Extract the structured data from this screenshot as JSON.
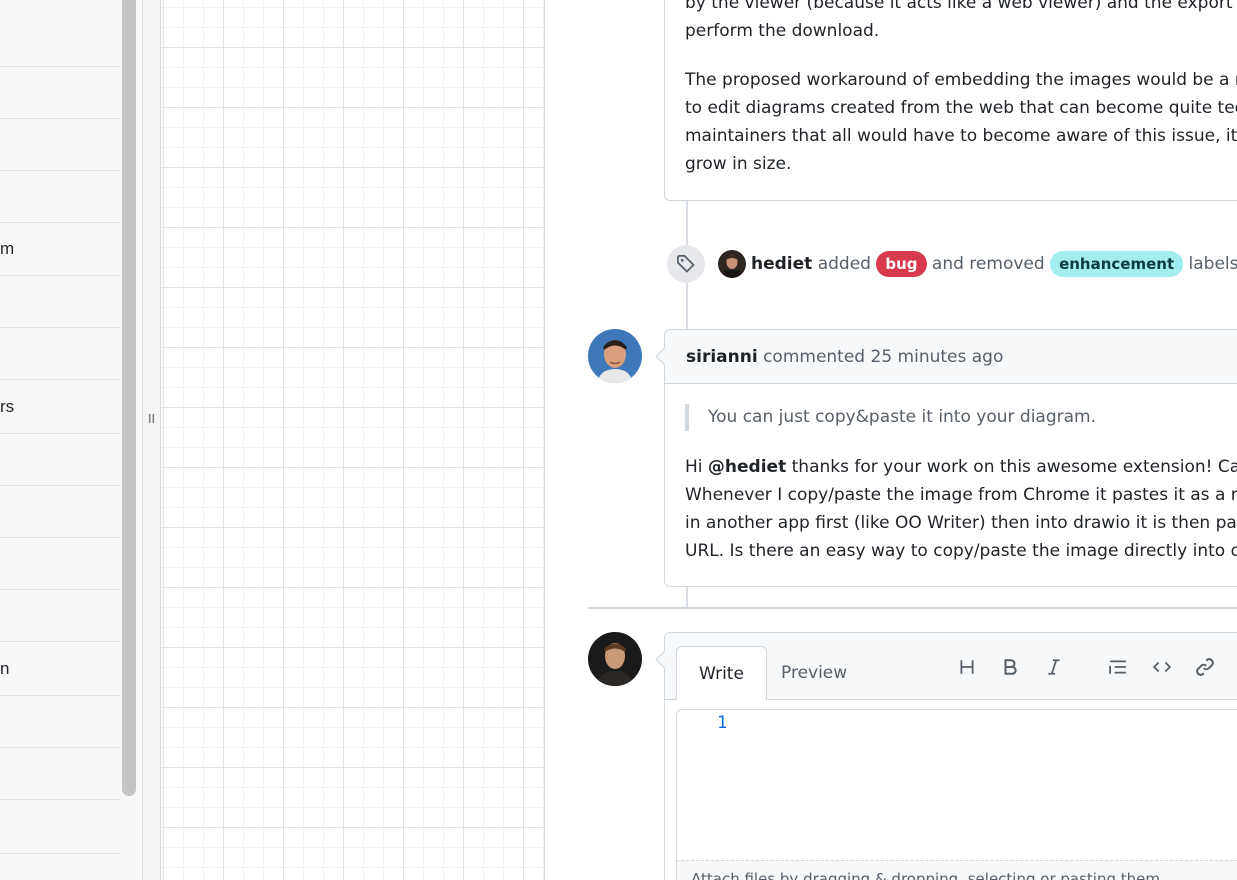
{
  "sidebar": {
    "items": [
      {
        "label": ""
      },
      {
        "label": ""
      },
      {
        "label": ""
      },
      {
        "label": "m"
      },
      {
        "label": ""
      },
      {
        "label": ""
      },
      {
        "label": "rs"
      },
      {
        "label": ""
      },
      {
        "label": ""
      },
      {
        "label": ""
      },
      {
        "label": ""
      },
      {
        "label": ""
      },
      {
        "label": "n"
      },
      {
        "label": ""
      },
      {
        "label": ""
      }
    ],
    "splitter_grip": "II"
  },
  "issue": {
    "previous_comment": {
      "lines": [
        "by the viewer (because it acts like a web viewer) and the export wo",
        "perform the download."
      ],
      "paragraph2": [
        "The proposed workaround of embedding the images would be a m",
        "to edit diagrams created from the web that can become quite tedic",
        "maintainers that all would have to become aware of this issue, it al",
        "grow in size."
      ]
    },
    "label_event": {
      "user": "hediet",
      "added_text": "added",
      "added_label": "bug",
      "added_label_color": "#d73a4a",
      "removed_text": "and removed",
      "removed_label": "enhancement",
      "removed_label_color": "#a2eeef",
      "suffix": "labels or"
    },
    "comment": {
      "author": "sirianni",
      "meta": "commented 25 minutes ago",
      "quote": "You can just copy&paste it into your diagram.",
      "body": {
        "greeting": "Hi ",
        "mention": "@hediet",
        "line1_rest": " thanks for your work on this awesome extension! Can y",
        "line2": "Whenever I copy/paste the image from Chrome it pastes it as a ref",
        "line3": "in another app first (like OO Writer) then into drawio it is then past",
        "line4": "URL. Is there an easy way to copy/paste the image directly into dra"
      }
    },
    "editor": {
      "tabs": [
        {
          "label": "Write"
        },
        {
          "label": "Preview"
        }
      ],
      "line_number": "1",
      "footer_hint": "Attach files by dragging & dropping, selecting or pasting them."
    }
  },
  "icons": [
    "tag-icon",
    "heading-icon",
    "bold-icon",
    "italic-icon",
    "list-icon",
    "code-icon",
    "link-icon"
  ]
}
